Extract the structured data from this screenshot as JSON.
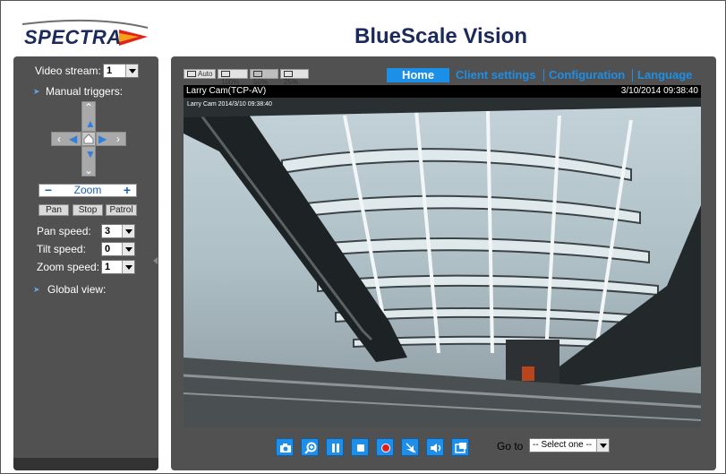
{
  "header": {
    "logo_text": "SPECTRA",
    "app_title": "BlueScale Vision"
  },
  "left_panel": {
    "video_stream": {
      "label": "Video stream:",
      "value": "1"
    },
    "manual_triggers_label": "Manual triggers:",
    "zoom": {
      "minus": "−",
      "label": "Zoom",
      "plus": "+"
    },
    "ptz_buttons": {
      "pan": "Pan",
      "stop": "Stop",
      "patrol": "Patrol"
    },
    "pan_speed": {
      "label": "Pan speed:",
      "value": "3"
    },
    "tilt_speed": {
      "label": "Tilt speed:",
      "value": "0"
    },
    "zoom_speed": {
      "label": "Zoom speed:",
      "value": "1"
    },
    "global_view_label": "Global view:"
  },
  "main_panel": {
    "size_buttons": {
      "auto": "Auto",
      "p100": "100%",
      "p50": "50%",
      "p25": "25%"
    },
    "nav": {
      "home": "Home",
      "client_settings": "Client settings",
      "configuration": "Configuration",
      "language": "Language"
    },
    "camera": {
      "name": "Larry Cam(TCP-AV)",
      "timestamp": "3/10/2014 09:38:40",
      "osd": "Larry Cam 2014/3/10 09:38:40"
    },
    "toolbar_icons": [
      "camera-icon",
      "digital-zoom-icon",
      "pause-icon",
      "stop-icon",
      "record-icon",
      "volume-down-icon",
      "speaker-icon",
      "fullscreen-icon"
    ],
    "goto": {
      "label": "Go to",
      "selected": "-- Select one --"
    }
  },
  "colors": {
    "panel_bg": "#515151",
    "accent_blue": "#1c8fe6",
    "title_navy": "#1b2a5a",
    "record_red": "#e21b1b"
  }
}
